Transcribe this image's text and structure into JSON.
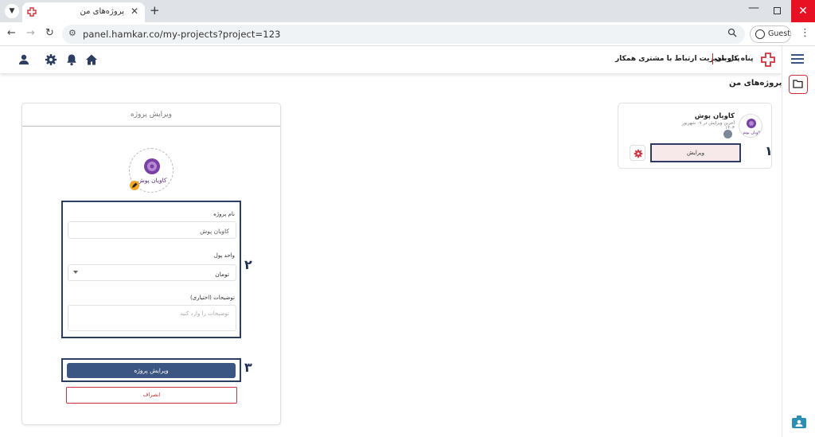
{
  "browser": {
    "tab_title": "پروژه‌های من",
    "url": "panel.hamkar.co/my-projects?project=123",
    "profile_label": "Guest"
  },
  "header": {
    "brand_name": "پناه کاویان",
    "brand_subtitle": "پنل مدیریت ارتباط با مشتری همکار"
  },
  "page": {
    "title": "پروژه‌های من"
  },
  "project_card": {
    "name": "کاویان پوش",
    "last_edit": "آخرین ویرایش در ۰۷ شهریور ۱۴۰۳",
    "edit_label": "ویرایش",
    "logo_text": "کاویان پوش"
  },
  "edit_panel": {
    "title": "ویرایش پروژه",
    "logo_text": "کاویان پوش",
    "name_label": "نام پروژه",
    "name_value": "کاویان پوش",
    "currency_label": "واحد پول",
    "currency_value": "تومان",
    "description_label": "توضیحات (اختیاری)",
    "description_placeholder": "توضیحات را وارد کنید",
    "submit_label": "ویرایش پروژه",
    "cancel_label": "انصراف"
  },
  "markers": {
    "one": "۱",
    "two": "۲",
    "three": "۳"
  },
  "colors": {
    "brand_red": "#d0323c",
    "navy": "#2d3e63",
    "primary_button": "#3b5683",
    "logo_purple": "#7b3fa6"
  }
}
